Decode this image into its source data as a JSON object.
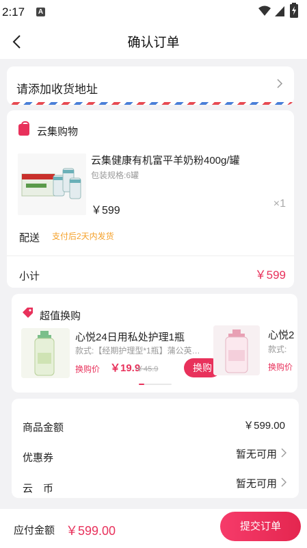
{
  "status_bar": {
    "time": "2:17",
    "notification_icon_letter": "A"
  },
  "nav": {
    "title": "确认订单"
  },
  "address": {
    "placeholder_text": "请添加收货地址"
  },
  "shop": {
    "name": "云集购物",
    "product": {
      "name": "云集健康有机富平羊奶粉400g/罐",
      "spec": "包装规格:6罐",
      "price": "￥599",
      "quantity": "×1"
    },
    "shipping": {
      "label": "配送",
      "note": "支付后2天内发货"
    },
    "subtotal": {
      "label": "小计",
      "value": "￥599"
    }
  },
  "swap_deal": {
    "title": "超值换购",
    "items": [
      {
        "name": "心悦24日用私处护理1瓶",
        "spec": "款式:【经期护理型*1瓶】蒲公英…",
        "price_label": "换购价",
        "price": "￥19.9",
        "original_price": "￥45.9",
        "button_label": "换购"
      },
      {
        "name": "心悦2",
        "spec": "款式:",
        "price_label": "换购价"
      }
    ]
  },
  "summary": {
    "rows": [
      {
        "label": "商品金额",
        "value": "￥599.00"
      },
      {
        "label": "优惠券",
        "value": "暂无可用"
      },
      {
        "label": "云　币",
        "value": "暂无可用"
      }
    ]
  },
  "bottom_bar": {
    "total_label": "应付金额",
    "total_value": "￥599.00",
    "submit_label": "提交订单"
  },
  "colors": {
    "accent": "#e8315b",
    "shipping_note": "#f5a12a",
    "background": "#f2f2f4"
  }
}
